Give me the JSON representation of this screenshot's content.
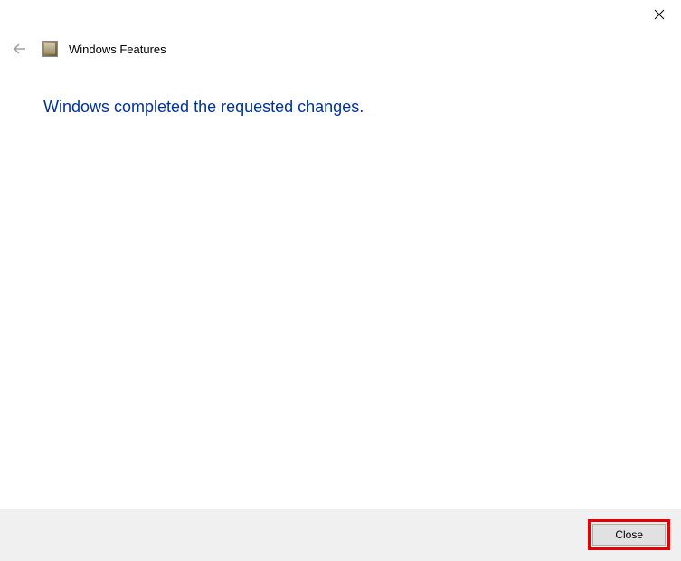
{
  "titlebar": {
    "close_icon": "×"
  },
  "header": {
    "title": "Windows Features"
  },
  "main": {
    "message": "Windows completed the requested changes."
  },
  "footer": {
    "close_label": "Close"
  },
  "colors": {
    "message_color": "#003399",
    "footer_bg": "#f0f0f0",
    "highlight_border": "#e60000"
  }
}
